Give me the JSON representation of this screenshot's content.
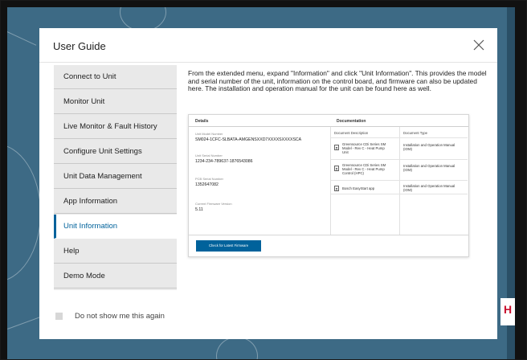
{
  "dialog": {
    "title": "User Guide",
    "close_icon": "close-icon"
  },
  "sidebar": {
    "items": [
      {
        "label": "Connect to Unit",
        "active": false
      },
      {
        "label": "Monitor Unit",
        "active": false
      },
      {
        "label": "Live Monitor & Fault History",
        "active": false
      },
      {
        "label": "Configure Unit Settings",
        "active": false
      },
      {
        "label": "Unit Data Management",
        "active": false
      },
      {
        "label": "App Information",
        "active": false
      },
      {
        "label": "Unit Information",
        "active": true
      },
      {
        "label": "Help",
        "active": false
      },
      {
        "label": "Demo Mode",
        "active": false
      }
    ]
  },
  "content": {
    "intro": "From the extended menu, expand \"Information\" and click \"Unit Information\". This provides the model and serial number of the unit, information on the control board, and firmware can also be updated here. The installation and operation manual for the unit can be found here as well."
  },
  "preview": {
    "details_heading": "Details",
    "documentation_heading": "Documentation",
    "fields": [
      {
        "label": "Unit Model Number",
        "value": "SM024-1CFC-SLBATA-AMGENSXXD7XXXXSXXXXSCA"
      },
      {
        "label": "Unit Serial Number",
        "value": "1234-234-789637-1876543086"
      },
      {
        "label": "PCB Serial Number",
        "value": "1352647082"
      },
      {
        "label": "Current Firmware Version",
        "value": "5.11"
      }
    ],
    "doc_columns": [
      "Document Description",
      "Document Type"
    ],
    "documents": [
      {
        "description": "Greensource CDi Series SM Model - Rev C - Heat Pump Unit",
        "type": "Installation and Operation Manual (IOM)",
        "icon": "document-icon"
      },
      {
        "description": "Greensource CDi Series SM Model - Rev C - Heat Pump Control (HPC)",
        "type": "Installation and Operation Manual (IOM)",
        "icon": "document-icon"
      },
      {
        "description": "Bosch EasyStart app",
        "type": "Installation and Operation Manual (IOM)",
        "icon": "document-icon"
      }
    ],
    "firmware_button": "Check for Latest Firmware"
  },
  "footer": {
    "checkbox_label": "Do not show me this again",
    "checked": false
  },
  "colors": {
    "accent": "#00629b",
    "backdrop": "#3d6a85",
    "sidebar_bg": "#e9e9e9",
    "brand_red": "#c8102e"
  },
  "background": {
    "brand_letter": "H"
  }
}
